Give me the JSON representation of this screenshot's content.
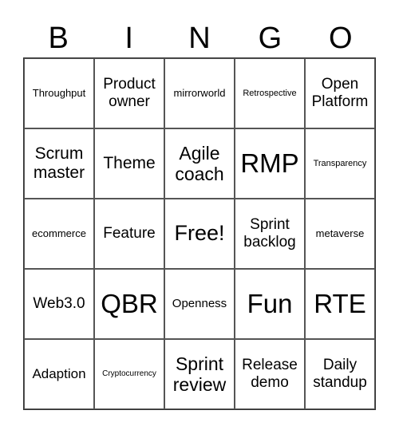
{
  "header": {
    "letters": [
      "B",
      "I",
      "N",
      "G",
      "O"
    ]
  },
  "board": {
    "cells": [
      "Throughput",
      "Product owner",
      "mirrorworld",
      "Retrospective",
      "Open Platform",
      "Scrum master",
      "Theme",
      "Agile coach",
      "RMP",
      "Transparency",
      "ecommerce",
      "Feature",
      "Free!",
      "Sprint backlog",
      "metaverse",
      "Web3.0",
      "QBR",
      "Openness",
      "Fun",
      "RTE",
      "Adaption",
      "Cryptocurrency",
      "Sprint review",
      "Release demo",
      "Daily standup"
    ]
  }
}
